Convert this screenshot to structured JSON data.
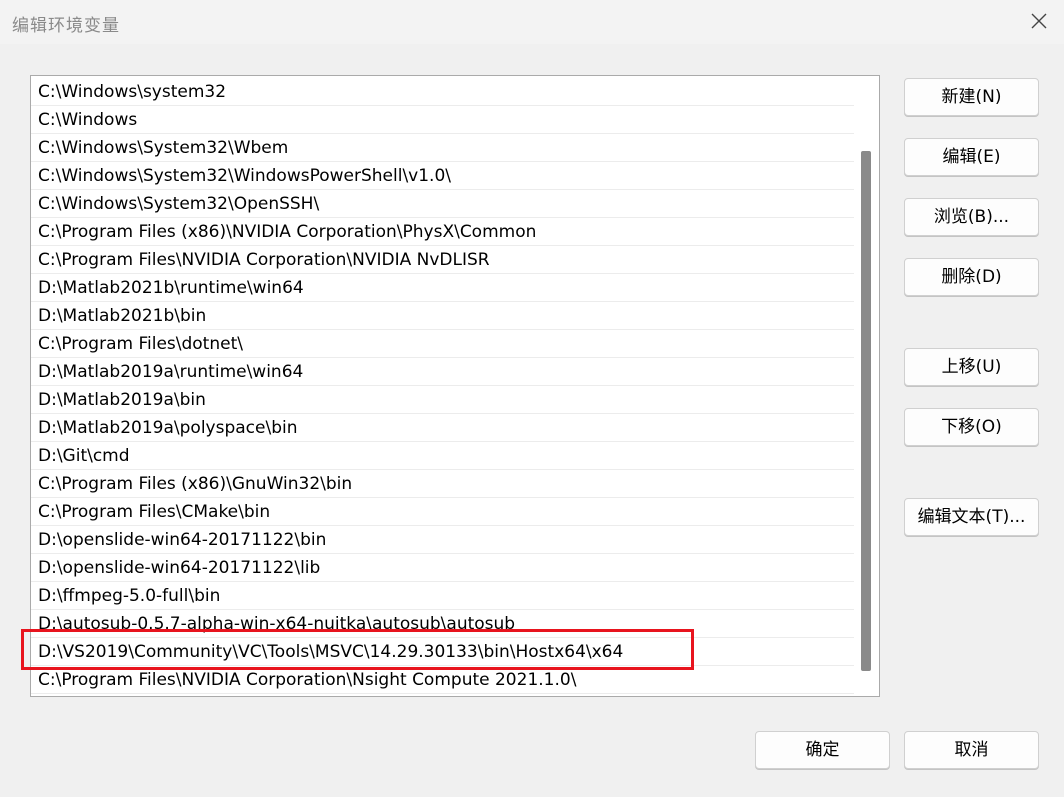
{
  "window": {
    "title": "编辑环境变量",
    "close_icon": "close-icon"
  },
  "paths": [
    "C:\\Windows\\system32",
    "C:\\Windows",
    "C:\\Windows\\System32\\Wbem",
    "C:\\Windows\\System32\\WindowsPowerShell\\v1.0\\",
    "C:\\Windows\\System32\\OpenSSH\\",
    "C:\\Program Files (x86)\\NVIDIA Corporation\\PhysX\\Common",
    "C:\\Program Files\\NVIDIA Corporation\\NVIDIA NvDLISR",
    "D:\\Matlab2021b\\runtime\\win64",
    "D:\\Matlab2021b\\bin",
    "C:\\Program Files\\dotnet\\",
    "D:\\Matlab2019a\\runtime\\win64",
    "D:\\Matlab2019a\\bin",
    "D:\\Matlab2019a\\polyspace\\bin",
    "D:\\Git\\cmd",
    "C:\\Program Files (x86)\\GnuWin32\\bin",
    "C:\\Program Files\\CMake\\bin",
    "D:\\openslide-win64-20171122\\bin",
    "D:\\openslide-win64-20171122\\lib",
    "D:\\ffmpeg-5.0-full\\bin",
    "D:\\autosub-0.5.7-alpha-win-x64-nuitka\\autosub\\autosub",
    "D:\\VS2019\\Community\\VC\\Tools\\MSVC\\14.29.30133\\bin\\Hostx64\\x64",
    "C:\\Program Files\\NVIDIA Corporation\\Nsight Compute 2021.1.0\\"
  ],
  "buttons": {
    "new": "新建(N)",
    "edit": "编辑(E)",
    "browse": "浏览(B)...",
    "delete": "删除(D)",
    "move_up": "上移(U)",
    "move_down": "下移(O)",
    "edit_text": "编辑文本(T)...",
    "ok": "确定",
    "cancel": "取消"
  },
  "colors": {
    "highlight_border": "#e8141e"
  }
}
